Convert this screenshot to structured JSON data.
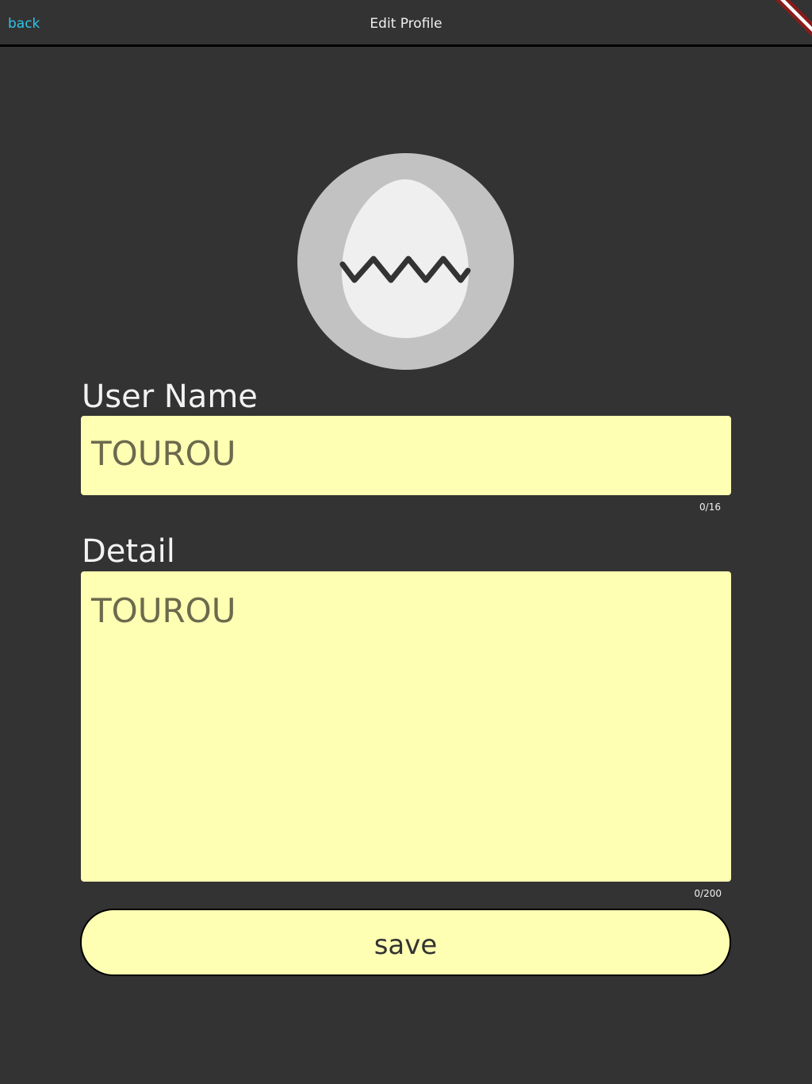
{
  "header": {
    "back_label": "back",
    "title": "Edit Profile"
  },
  "avatar": {
    "icon": "cracked-egg-icon"
  },
  "user_name": {
    "label": "User Name",
    "value": "TOUROU",
    "counter": "0/16"
  },
  "detail": {
    "label": "Detail",
    "value": "TOUROU",
    "counter": "0/200"
  },
  "actions": {
    "save_label": "save"
  },
  "colors": {
    "background": "#333333",
    "accent_link": "#2ec4e8",
    "field_fill": "#ffffb3",
    "field_text": "#6b6a4d",
    "debug_banner": "#8b1a1a"
  }
}
